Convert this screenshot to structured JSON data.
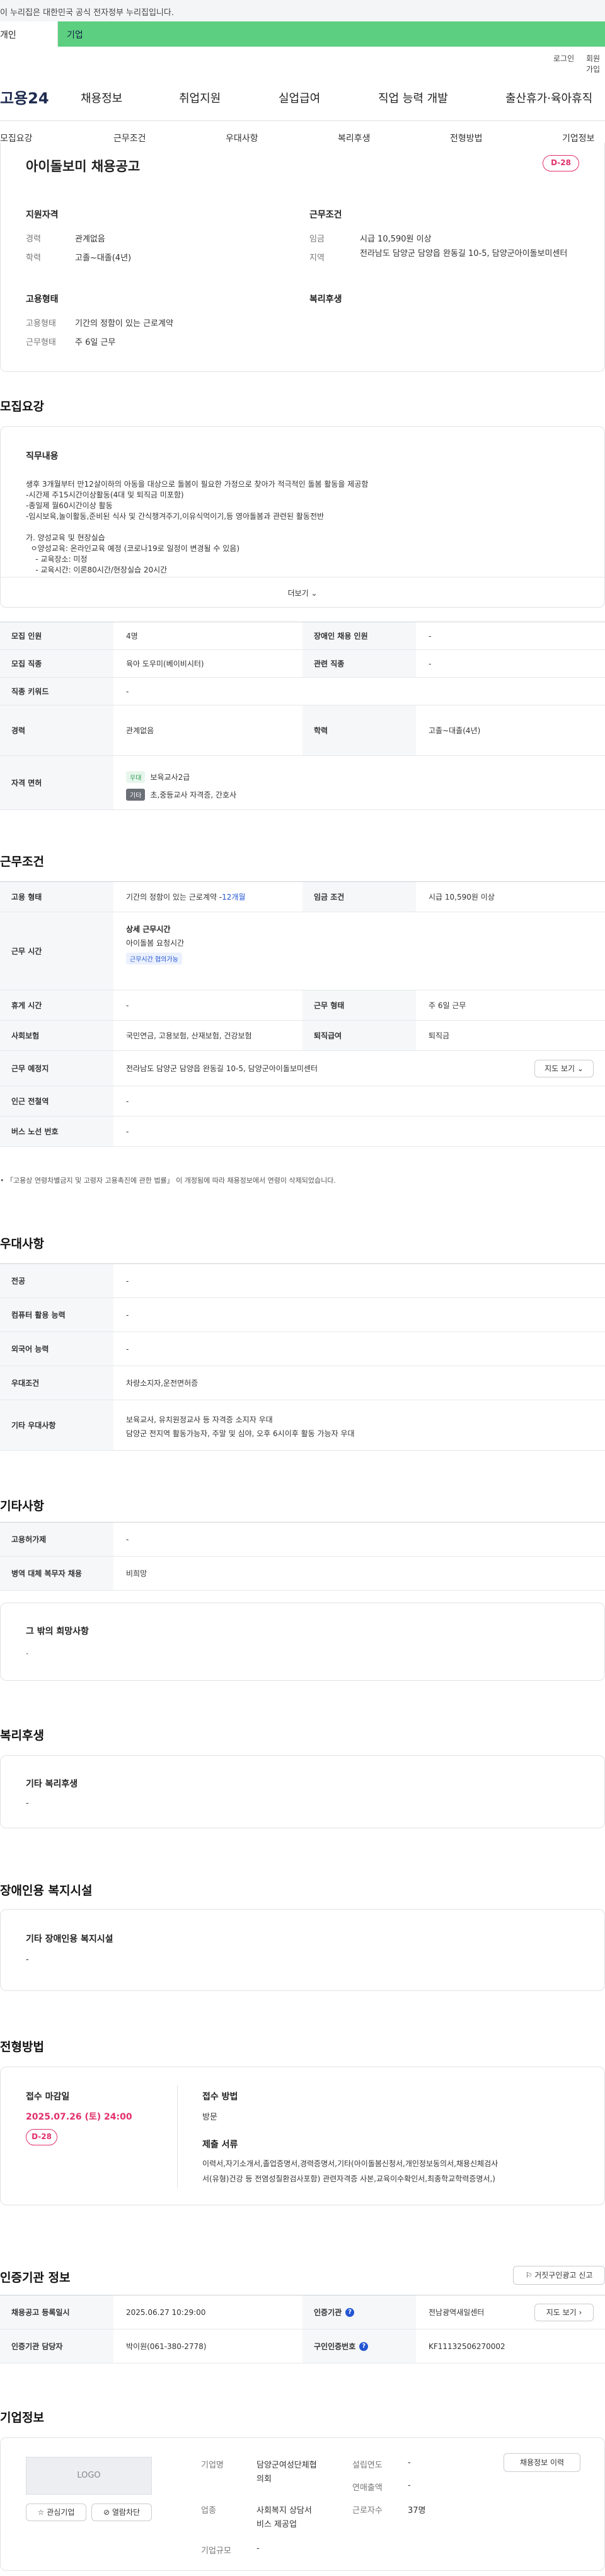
{
  "notice": {
    "text": "이 누리집은 대한민국 공식 전자정부 누리집입니다.",
    "left_label": "개인",
    "right_label": "기업"
  },
  "util": {
    "login": "로그인",
    "join": "회원가입"
  },
  "header": {
    "logo": "고용24",
    "menu": [
      "채용정보",
      "취업지원",
      "실업급여",
      "직업 능력 개발",
      "출산휴가·육아휴직"
    ]
  },
  "subnav": [
    "모집요강",
    "근무조건",
    "우대사항",
    "복리후생",
    "전형방법",
    "기업정보"
  ],
  "summary": {
    "title": "아이돌보미 채용공고",
    "dday": "D-28",
    "qual_head": "지원자격",
    "career_l": "경력",
    "career_v": "관계없음",
    "edu_l": "학력",
    "edu_v": "고졸~대졸(4년)",
    "cond_head": "근무조건",
    "wage_l": "임금",
    "wage_v": "시급 10,590원 이상",
    "area_l": "지역",
    "area_v": "전라남도 담양군 담양읍 완동길 10-5, 담양군아이돌보미센터",
    "emp_head": "고용형태",
    "emp_l": "고용형태",
    "emp_v": "기간의 정함이 있는 근로계약",
    "workform_l": "근무형태",
    "workform_v": "주 6일 근무",
    "welfare_head": "복리후생"
  },
  "recruit": {
    "section_title": "모집요강",
    "duty_head": "직무내용",
    "duty_lines": [
      "생후 3개월부터 만12살이하의 아동을 대상으로 돌봄이 필요한 가정으로 찾아가 적극적인 돌봄 활동을 제공함",
      "-시간제 주15시간이상활동(4대 및 퇴직금 미포함)",
      "-종일제 월60시간이상 활동",
      "-임시보육,놀이활동,준비된 식사 및 간식챙겨주기,이유식먹이기,등 영아돌봄과 관련된 활동전반",
      "",
      "가. 양성교육 및 현장실습",
      "  ㅇ양성교육: 온라인교육 예정 (코로나19로 일정이 변경될 수 있음)",
      "    - 교육장소: 미정",
      "    - 교육시간: 이론80시간/현장실습 20시간"
    ],
    "more": "더보기",
    "rows": {
      "count_l": "모집 인원",
      "count_v": "4명",
      "disabled_l": "장애인 채용 인원",
      "disabled_v": "-",
      "job_l": "모집 직종",
      "job_v": "육아 도우미(베이비시터)",
      "related_l": "관련 직종",
      "related_v": "-",
      "keyword_l": "직종 키워드",
      "keyword_v": "-",
      "career_l": "경력",
      "career_v": "관계없음",
      "edu_l": "학력",
      "edu_v": "고졸~대졸(4년)",
      "license_l": "자격 면허",
      "lic1_tag": "우대",
      "lic1_v": "보육교사2급",
      "lic2_tag": "기타",
      "lic2_v": "초,중등교사 자격증, 간호사"
    }
  },
  "work": {
    "section_title": "근무조건",
    "emp_l": "고용 형태",
    "emp_v": "기간의 정함이 있는 근로계약 - ",
    "emp_period": "12개월",
    "wage_l": "임금 조건",
    "wage_v": "시급 10,590원 이상",
    "time_l": "근무 시간",
    "time_head": "상세 근무시간",
    "time_v": "아이돌봄 요청시간",
    "time_tag": "근무시간 협의가능",
    "holiday_l": "휴게 시간",
    "holiday_v": "-",
    "form_l": "근무 형태",
    "form_v": "주 6일 근무",
    "ins_l": "사회보험",
    "ins_v": "국민연금, 고용보험, 산재보험, 건강보험",
    "ret_l": "퇴직급여",
    "ret_v": "퇴직금",
    "place_l": "근무 예정지",
    "place_v": "전라남도 담양군 담양읍 완동길 10-5, 담양군아이돌보미센터",
    "map_btn": "지도 보기",
    "subway_l": "인근 전철역",
    "subway_v": "-",
    "bus_l": "버스 노선 번호",
    "bus_v": "-",
    "note": "「고용상 연령차별금지 및 고령자 고용촉진에 관한 법률」 이 개정됨에 따라 채용정보에서 연령이 삭제되었습니다."
  },
  "pref": {
    "section_title": "우대사항",
    "major_l": "전공",
    "major_v": "-",
    "pc_l": "컴퓨터 활용 능력",
    "pc_v": "-",
    "lang_l": "외국어 능력",
    "lang_v": "-",
    "cond_l": "우대조건",
    "cond_v": "차량소지자,운전면허증",
    "etc_l": "기타 우대사항",
    "etc_v1": "보육교사, 유치원정교사 등 자격증 소지자 우대",
    "etc_v2": "담양군 전지역 활동가능자, 주말 및 심야, 오후 6시이후 활동 가능자 우대"
  },
  "other": {
    "section_title": "기타사항",
    "type_l": "고용허가제",
    "type_v": "-",
    "military_l": "병역 대체 복무자 채용",
    "military_v": "비희망",
    "wish_head": "그 밖의 희망사항",
    "wish_v": "."
  },
  "welfare": {
    "section_title": "복리후생",
    "head": "기타 복리후생",
    "v": "-"
  },
  "disab": {
    "section_title": "장애인용 복지시설",
    "head": "기타 장애인용 복지시설",
    "v": "-"
  },
  "selection": {
    "section_title": "전형방법",
    "deadline_head": "접수 마감일",
    "deadline_v": "2025.07.26 (토) 24:00",
    "dday": "D-28",
    "method_head": "접수 방법",
    "method_v": "방문",
    "docs_head": "제출 서류",
    "docs_v1": "이력서,자기소개서,졸업증명서,경력증명서,기타(아이돌봄신청서,개인정보동의서,채용신체검사",
    "docs_v2": "서(유형)건강 등 전염성질환검사포함) 관련자격증 사본,교육이수확인서,최종학교학력증명서,)"
  },
  "agency": {
    "section_title": "인증기관 정보",
    "report_btn": "거짓구인광고 신고",
    "reg_l": "채용공고 등록일시",
    "reg_v": "2025.06.27 10:29:00",
    "org_l": "인증기관",
    "org_v": "전남광역새일센터",
    "map_btn": "지도 보기",
    "manager_l": "인증기관 담당자",
    "manager_v": "박이원(061-380-2778)",
    "num_l": "구인인증번호",
    "num_v": "KF11132506270002"
  },
  "company": {
    "section_title": "기업정보",
    "logo_text": "LOGO",
    "fav_btn": "관심기업",
    "block_btn": "열람차단",
    "name_l": "기업명",
    "name_v1": "담양군여성단체협",
    "name_v2": "의회",
    "industry_l": "업종",
    "industry_v1": "사회복지 상담서",
    "industry_v2": "비스 제공업",
    "size_l": "기업규모",
    "size_v": "-",
    "founded_l": "설립연도",
    "founded_v": "-",
    "sales_l": "연매출액",
    "sales_v": "-",
    "emp_l": "근로자수",
    "emp_v": "37명",
    "history_btn": "채용정보 이력"
  }
}
